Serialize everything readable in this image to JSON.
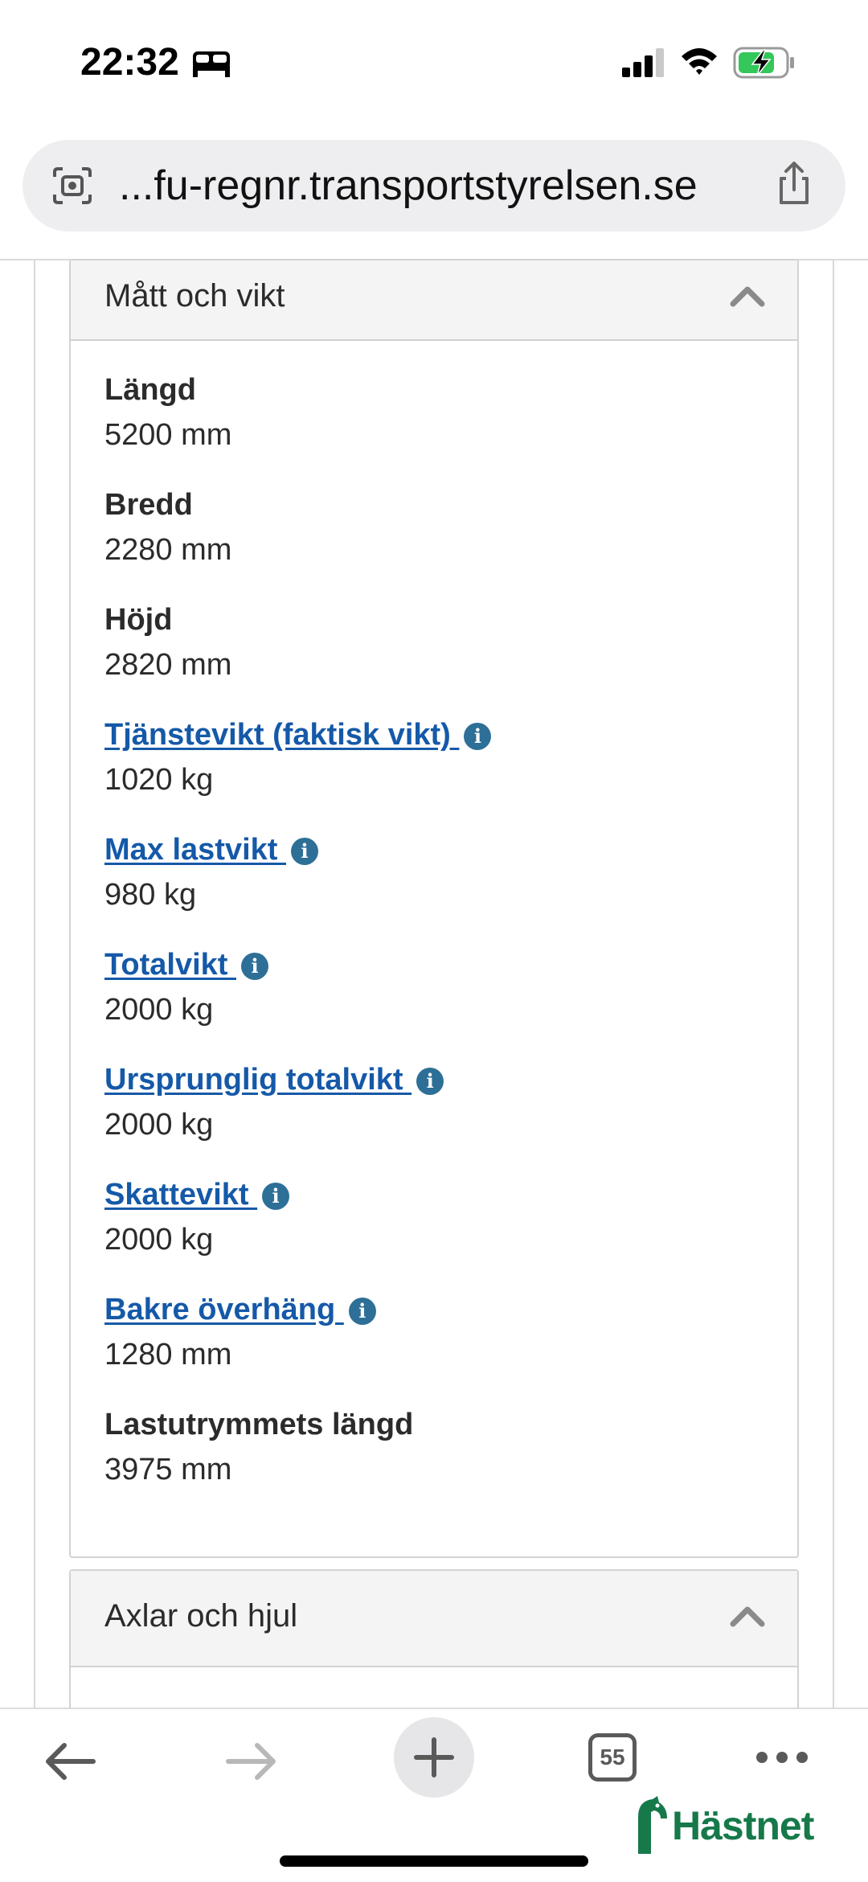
{
  "status_bar": {
    "time": "22:32"
  },
  "browser": {
    "url": "...fu-regnr.transportstyrelsen.se",
    "tab_count": "55"
  },
  "section_matt": {
    "title": "Mått och vikt",
    "items": [
      {
        "label": "Längd",
        "value": "5200 mm",
        "link": false
      },
      {
        "label": "Bredd",
        "value": "2280 mm",
        "link": false
      },
      {
        "label": "Höjd",
        "value": "2820 mm",
        "link": false
      },
      {
        "label": "Tjänstevikt (faktisk vikt) ",
        "value": "1020 kg",
        "link": true
      },
      {
        "label": "Max lastvikt ",
        "value": "980 kg",
        "link": true
      },
      {
        "label": "Totalvikt ",
        "value": "2000 kg",
        "link": true
      },
      {
        "label": "Ursprunglig totalvikt ",
        "value": "2000 kg",
        "link": true
      },
      {
        "label": "Skattevikt ",
        "value": "2000 kg",
        "link": true
      },
      {
        "label": "Bakre överhäng ",
        "value": "1280 mm",
        "link": true
      },
      {
        "label": "Lastutrymmets längd",
        "value": "3975 mm",
        "link": false
      }
    ]
  },
  "section_axlar": {
    "title": "Axlar och hjul"
  },
  "overlay": {
    "logo_text": "Hästnet"
  },
  "icons": {
    "info": "info-icon",
    "chevron": "chevron-up-icon"
  },
  "colors": {
    "link": "#1559a8",
    "info_icon_bg": "#2d6f97",
    "logo_green": "#16794a"
  }
}
